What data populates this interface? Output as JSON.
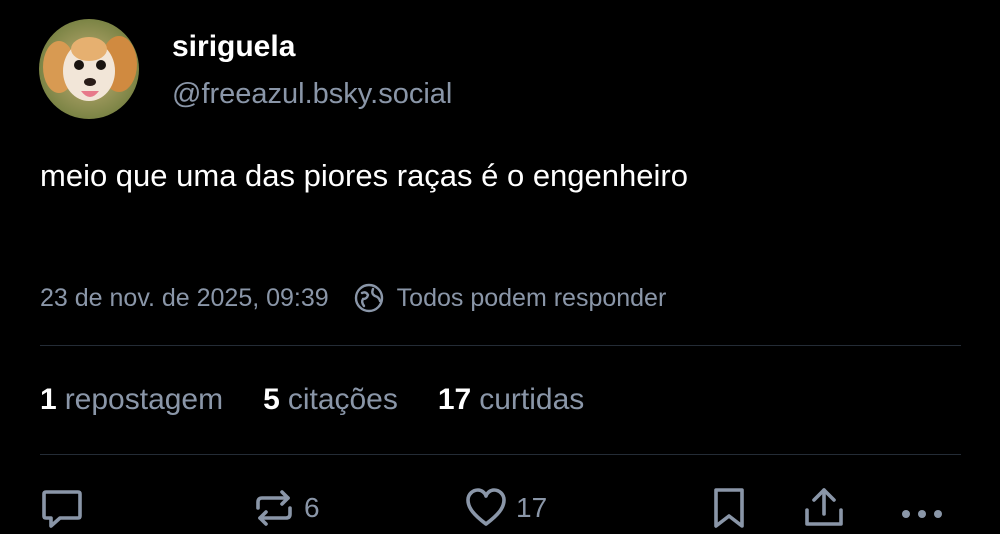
{
  "author": {
    "name": "siriguela",
    "handle": "@freeazul.bsky.social"
  },
  "post": {
    "text": "meio que uma das piores raças é o engenheiro",
    "timestamp": "23 de nov. de 2025, 09:39",
    "reply_setting": "Todos podem responder"
  },
  "stats": {
    "reposts_count": "1",
    "reposts_label": "repostagem",
    "quotes_count": "5",
    "quotes_label": "citações",
    "likes_count": "17",
    "likes_label": "curtidas"
  },
  "actions": {
    "reply_count": "",
    "repost_count": "6",
    "like_count": "17"
  },
  "colors": {
    "background": "#000000",
    "text_primary": "#ffffff",
    "text_secondary": "#8a96a8",
    "divider": "#242c36"
  },
  "icons": [
    "reply-icon",
    "repost-icon",
    "heart-icon",
    "bookmark-icon",
    "share-icon",
    "more-icon",
    "globe-icon"
  ]
}
